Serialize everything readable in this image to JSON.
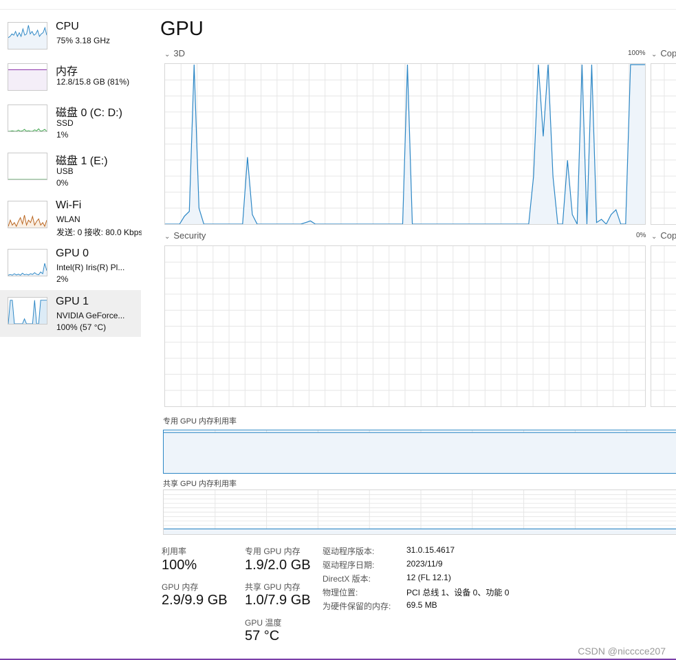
{
  "title": "GPU",
  "sidebar": {
    "items": [
      {
        "name": "CPU",
        "sub1": "75% 3.18 GHz",
        "sub2": ""
      },
      {
        "name": "内存",
        "sub1": "12.8/15.8 GB (81%)",
        "sub2": ""
      },
      {
        "name": "磁盘 0 (C: D:)",
        "sub1": "SSD",
        "sub2": "1%"
      },
      {
        "name": "磁盘 1 (E:)",
        "sub1": "USB",
        "sub2": "0%"
      },
      {
        "name": "Wi-Fi",
        "sub1": "WLAN",
        "sub2": "发送: 0 接收: 80.0 Kbps"
      },
      {
        "name": "GPU 0",
        "sub1": "Intel(R) Iris(R) Pl...",
        "sub2": "2%"
      },
      {
        "name": "GPU 1",
        "sub1": "NVIDIA GeForce...",
        "sub2": "100% (57 °C)"
      }
    ],
    "selected_index": 6
  },
  "engines": [
    {
      "label": "3D",
      "max_label": "100%",
      "next_label": "Cop",
      "series": [
        0,
        0,
        0,
        0,
        0.05,
        0.08,
        1,
        0.1,
        0,
        0,
        0,
        0,
        0,
        0,
        0,
        0,
        0,
        0.42,
        0.06,
        0,
        0,
        0,
        0,
        0,
        0,
        0,
        0,
        0,
        0,
        0.01,
        0.02,
        0,
        0,
        0,
        0,
        0,
        0,
        0,
        0,
        0,
        0,
        0,
        0,
        0,
        0,
        0,
        0,
        0,
        0,
        0,
        1,
        0,
        0,
        0,
        0,
        0,
        0,
        0,
        0,
        0,
        0,
        0,
        0,
        0,
        0,
        0,
        0,
        0,
        0,
        0,
        0,
        0,
        0,
        0,
        0,
        0,
        0.3,
        1,
        0.55,
        1,
        0.3,
        0,
        0,
        0.4,
        0.06,
        0,
        1,
        0,
        1,
        0.01,
        0.03,
        0,
        0.06,
        0.09,
        0,
        0,
        1,
        1,
        1,
        1
      ]
    },
    {
      "label": "Security",
      "max_label": "0%",
      "next_label": "Cop",
      "series": []
    }
  ],
  "memory_charts": {
    "dedicated_label": "专用 GPU 内存利用率",
    "dedicated_value": 0.95,
    "shared_label": "共享 GPU 内存利用率",
    "shared_value": 0.12
  },
  "stats": {
    "utilization_label": "利用率",
    "utilization_value": "100%",
    "dedicated_mem_label": "专用 GPU 内存",
    "dedicated_mem_value": "1.9/2.0 GB",
    "gpu_mem_label": "GPU 内存",
    "gpu_mem_value": "2.9/9.9 GB",
    "shared_mem_label": "共享 GPU 内存",
    "shared_mem_value": "1.0/7.9 GB",
    "temp_label": "GPU 温度",
    "temp_value": "57 °C"
  },
  "info": [
    {
      "key": "驱动程序版本:",
      "value": "31.0.15.4617"
    },
    {
      "key": "驱动程序日期:",
      "value": "2023/11/9"
    },
    {
      "key": "DirectX 版本:",
      "value": "12 (FL 12.1)"
    },
    {
      "key": "物理位置:",
      "value": "PCI 总线 1、设备 0、功能 0"
    },
    {
      "key": "为硬件保留的内存:",
      "value": "69.5 MB"
    }
  ],
  "watermark": "CSDN @nicccce207",
  "colors": {
    "gpu_line": "#2b86c5",
    "gpu_fill": "#eef4fa",
    "memory_line": "#8a2da8",
    "disk_line": "#3fa34d",
    "wifi_line": "#b8621b",
    "grid": "#e6e6e6"
  }
}
